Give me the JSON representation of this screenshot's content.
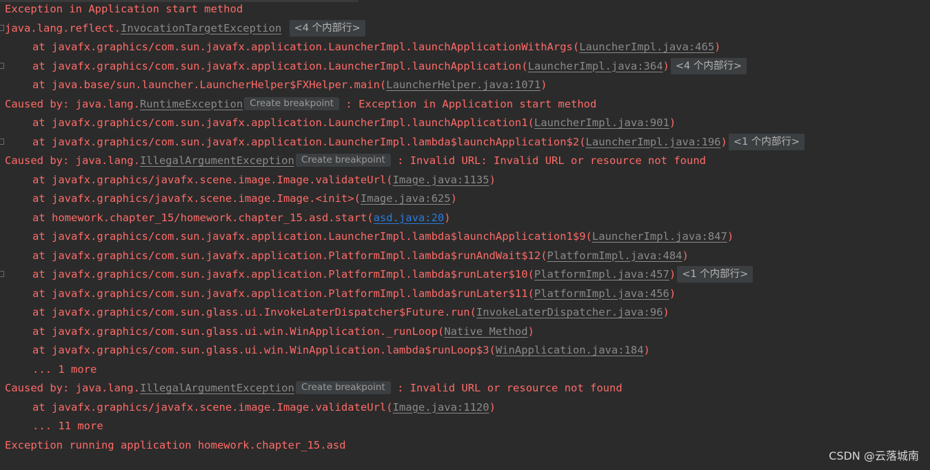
{
  "watermark": "CSDN @云落城南",
  "lines": [
    {
      "indent": false,
      "fold": false,
      "parts": [
        {
          "t": "Exception in Application start method"
        }
      ]
    },
    {
      "indent": false,
      "fold": true,
      "parts": [
        {
          "t": "java.lang.reflect."
        },
        {
          "t": "InvocationTargetException",
          "link": true
        },
        {
          "t": " "
        },
        {
          "t": "<4 个内部行>",
          "chip": "fold"
        }
      ]
    },
    {
      "indent": true,
      "fold": false,
      "parts": [
        {
          "t": "at javafx.graphics/com.sun.javafx.application.LauncherImpl.launchApplicationWithArgs("
        },
        {
          "t": "LauncherImpl.java:465",
          "link": true
        },
        {
          "t": ")"
        }
      ]
    },
    {
      "indent": true,
      "fold": true,
      "parts": [
        {
          "t": "at javafx.graphics/com.sun.javafx.application.LauncherImpl.launchApplication("
        },
        {
          "t": "LauncherImpl.java:364",
          "link": true
        },
        {
          "t": ")"
        },
        {
          "t": "<4 个内部行>",
          "chip": "fold"
        }
      ]
    },
    {
      "indent": true,
      "fold": false,
      "parts": [
        {
          "t": "at java.base/sun.launcher.LauncherHelper$FXHelper.main("
        },
        {
          "t": "LauncherHelper.java:1071",
          "link": true
        },
        {
          "t": ")"
        }
      ]
    },
    {
      "indent": false,
      "fold": false,
      "parts": [
        {
          "t": "Caused by: java.lang."
        },
        {
          "t": "RuntimeException",
          "link": true
        },
        {
          "t": "Create breakpoint",
          "chip": "bp"
        },
        {
          "t": " : Exception in Application start method"
        }
      ]
    },
    {
      "indent": true,
      "fold": false,
      "parts": [
        {
          "t": "at javafx.graphics/com.sun.javafx.application.LauncherImpl.launchApplication1("
        },
        {
          "t": "LauncherImpl.java:901",
          "link": true
        },
        {
          "t": ")"
        }
      ]
    },
    {
      "indent": true,
      "fold": true,
      "parts": [
        {
          "t": "at javafx.graphics/com.sun.javafx.application.LauncherImpl.lambda$launchApplication$2("
        },
        {
          "t": "LauncherImpl.java:196",
          "link": true
        },
        {
          "t": ")"
        },
        {
          "t": "<1 个内部行>",
          "chip": "fold"
        }
      ]
    },
    {
      "indent": false,
      "fold": false,
      "parts": [
        {
          "t": "Caused by: java.lang."
        },
        {
          "t": "IllegalArgumentException",
          "link": true
        },
        {
          "t": "Create breakpoint",
          "chip": "bp"
        },
        {
          "t": " : Invalid URL: Invalid URL or resource not found"
        }
      ]
    },
    {
      "indent": true,
      "fold": false,
      "parts": [
        {
          "t": "at javafx.graphics/javafx.scene.image.Image.validateUrl("
        },
        {
          "t": "Image.java:1135",
          "link": true
        },
        {
          "t": ")"
        }
      ]
    },
    {
      "indent": true,
      "fold": false,
      "parts": [
        {
          "t": "at javafx.graphics/javafx.scene.image.Image.<init>("
        },
        {
          "t": "Image.java:625",
          "link": true
        },
        {
          "t": ")"
        }
      ]
    },
    {
      "indent": true,
      "fold": false,
      "parts": [
        {
          "t": "at homework.chapter_15/homework.chapter_15.asd.start("
        },
        {
          "t": "asd.java:20",
          "link": true,
          "blue": true
        },
        {
          "t": ")"
        }
      ]
    },
    {
      "indent": true,
      "fold": false,
      "parts": [
        {
          "t": "at javafx.graphics/com.sun.javafx.application.LauncherImpl.lambda$launchApplication1$9("
        },
        {
          "t": "LauncherImpl.java:847",
          "link": true
        },
        {
          "t": ")"
        }
      ]
    },
    {
      "indent": true,
      "fold": false,
      "parts": [
        {
          "t": "at javafx.graphics/com.sun.javafx.application.PlatformImpl.lambda$runAndWait$12("
        },
        {
          "t": "PlatformImpl.java:484",
          "link": true
        },
        {
          "t": ")"
        }
      ]
    },
    {
      "indent": true,
      "fold": true,
      "parts": [
        {
          "t": "at javafx.graphics/com.sun.javafx.application.PlatformImpl.lambda$runLater$10("
        },
        {
          "t": "PlatformImpl.java:457",
          "link": true
        },
        {
          "t": ")"
        },
        {
          "t": "<1 个内部行>",
          "chip": "fold"
        }
      ]
    },
    {
      "indent": true,
      "fold": false,
      "parts": [
        {
          "t": "at javafx.graphics/com.sun.javafx.application.PlatformImpl.lambda$runLater$11("
        },
        {
          "t": "PlatformImpl.java:456",
          "link": true
        },
        {
          "t": ")"
        }
      ]
    },
    {
      "indent": true,
      "fold": false,
      "parts": [
        {
          "t": "at javafx.graphics/com.sun.glass.ui.InvokeLaterDispatcher$Future.run("
        },
        {
          "t": "InvokeLaterDispatcher.java:96",
          "link": true
        },
        {
          "t": ")"
        }
      ]
    },
    {
      "indent": true,
      "fold": false,
      "parts": [
        {
          "t": "at javafx.graphics/com.sun.glass.ui.win.WinApplication._runLoop("
        },
        {
          "t": "Native Method",
          "link": true
        },
        {
          "t": ")"
        }
      ]
    },
    {
      "indent": true,
      "fold": false,
      "parts": [
        {
          "t": "at javafx.graphics/com.sun.glass.ui.win.WinApplication.lambda$runLoop$3("
        },
        {
          "t": "WinApplication.java:184",
          "link": true
        },
        {
          "t": ")"
        }
      ]
    },
    {
      "indent": true,
      "fold": false,
      "parts": [
        {
          "t": "... 1 more"
        }
      ]
    },
    {
      "indent": false,
      "fold": false,
      "parts": [
        {
          "t": "Caused by: java.lang."
        },
        {
          "t": "IllegalArgumentException",
          "link": true
        },
        {
          "t": "Create breakpoint",
          "chip": "bp"
        },
        {
          "t": " : Invalid URL or resource not found"
        }
      ]
    },
    {
      "indent": true,
      "fold": false,
      "parts": [
        {
          "t": "at javafx.graphics/javafx.scene.image.Image.validateUrl("
        },
        {
          "t": "Image.java:1120",
          "link": true
        },
        {
          "t": ")"
        }
      ]
    },
    {
      "indent": true,
      "fold": false,
      "parts": [
        {
          "t": "... 11 more"
        }
      ]
    },
    {
      "indent": false,
      "fold": false,
      "parts": [
        {
          "t": "Exception running application homework.chapter_15.asd"
        }
      ]
    }
  ]
}
